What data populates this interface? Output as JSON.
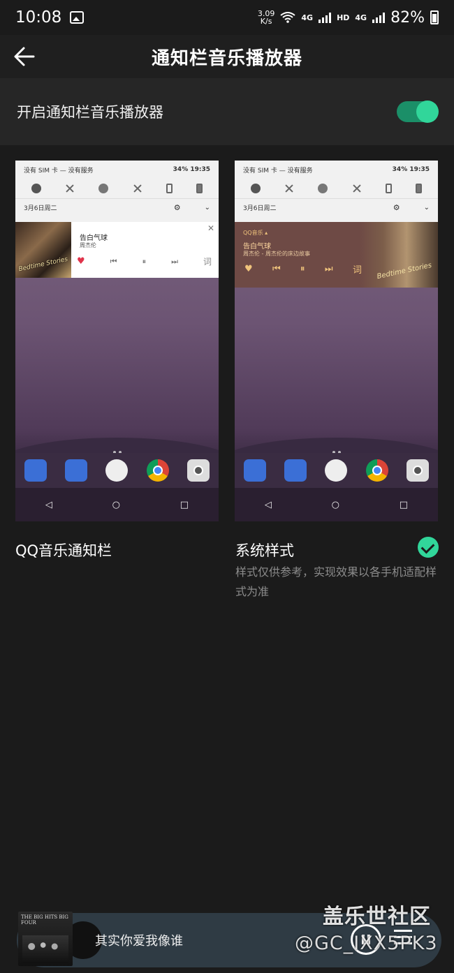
{
  "status_bar": {
    "time": "10:08",
    "net_speed": "3.09",
    "net_unit": "K/s",
    "net_4g_1": "4G",
    "hd": "HD",
    "net_4g_2": "4G",
    "battery": "82%"
  },
  "header": {
    "title": "通知栏音乐播放器"
  },
  "toggle": {
    "label": "开启通知栏音乐播放器",
    "on": true,
    "accent": "#31d69a"
  },
  "preview": {
    "status_left": "没有 SIM 卡 — 没有服务",
    "status_right": "34% 19:35",
    "date": "3月6日周二",
    "settings_glyph": "⚙",
    "expand_glyph": "⌄",
    "qq_card": {
      "title": "告白气球",
      "artist": "周杰伦",
      "close": "✕",
      "lyric": "词",
      "album_text": "Bedtime Stories"
    },
    "sys_card": {
      "app": "QQ音乐 ▴",
      "title": "告白气球",
      "subtitle": "周杰伦 - 周杰伦的床边故事",
      "lyric": "词",
      "album_text": "Bedtime Stories"
    },
    "nav": {
      "back": "◁",
      "home": "○",
      "recents": "□"
    }
  },
  "options": {
    "qq_label": "QQ音乐通知栏",
    "system_label": "系统样式",
    "system_selected": true,
    "note": "样式仅供参考，实现效果以各手机适配样式为准"
  },
  "mini_player": {
    "title": "其实你爱我像谁",
    "album_text": "THE BIG HITS BIG FOUR"
  },
  "watermark": {
    "line1": "盖乐世社区",
    "line2": "@GC_IXX5PK3"
  }
}
